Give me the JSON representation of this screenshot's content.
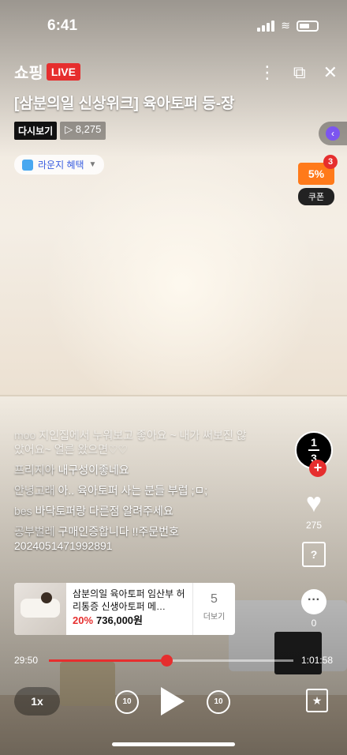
{
  "status_bar": {
    "time": "6:41"
  },
  "header": {
    "brand": "쇼핑",
    "live_badge": "LIVE",
    "title": "[삼분의일 신상위크] 육아토퍼 등-장",
    "replay_tag": "다시보기",
    "views": "▷ 8,275",
    "lounge_benefit": "라운지 혜택"
  },
  "coupon": {
    "percent": "5%",
    "count": "3",
    "label": "쿠폰"
  },
  "rail": {
    "brand_mark_top": "1",
    "brand_mark_bottom": "3",
    "like_count": "275",
    "question_icon_text": "?",
    "chat_count": "0"
  },
  "chat": [
    {
      "user": "moo",
      "text": "지인집에서 누워보고 좋아요 ~ 내가 써보진 않았어요~ 얼른 왔으면♡♡",
      "faded": true
    },
    {
      "user": "프리지아",
      "text": "내구성이좋네요"
    },
    {
      "user": "안녕고래",
      "text": "아.. 육아토퍼 사는 분들 부럽 ;ㅁ;"
    },
    {
      "user": "bes",
      "text": "바닥토퍼랑 다른점 알려주세요"
    },
    {
      "user": "공부벌레",
      "text": "구매인증합니다 !!주문번호 2024051471992891"
    }
  ],
  "product": {
    "name": "삼분의일 육아토퍼 임산부 허리통증 신생아토퍼 메…",
    "discount": "20%",
    "price": "736,000원",
    "more_count": "5",
    "more_label": "더보기"
  },
  "progress": {
    "current": "29:50",
    "total": "1:01:58",
    "fraction": 0.4814
  },
  "controls": {
    "speed": "1x",
    "rewind": "10",
    "forward": "10"
  }
}
